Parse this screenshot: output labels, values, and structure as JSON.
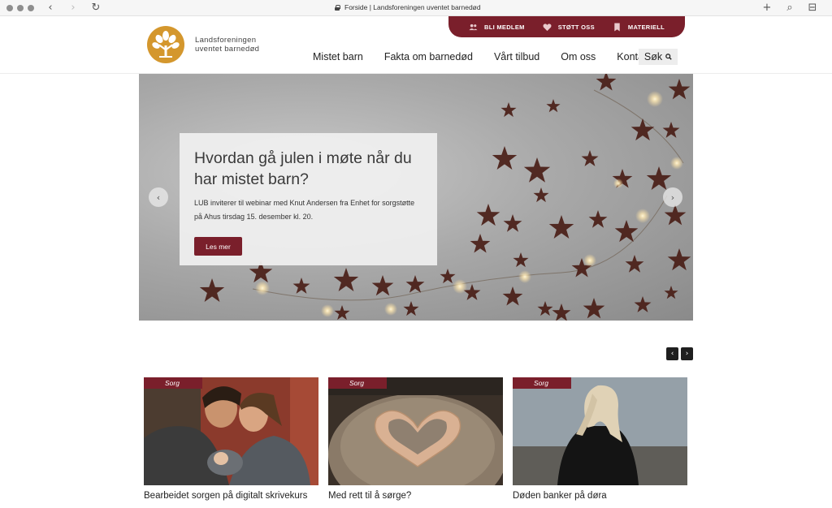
{
  "browser": {
    "url_title": "Forside | Landsforeningen uventet barnedød",
    "back": "‹",
    "forward": "›",
    "reload": "↻",
    "new_tab": "+",
    "search_glyph": "⌕",
    "sidebar_glyph": "⊟"
  },
  "brand": {
    "line1": "Landsforeningen",
    "line2": "uventet barnedød",
    "logo_color": "#d4972d"
  },
  "topbar": {
    "color": "#7a1f2b",
    "items": [
      {
        "label": "BLI MEDLEM",
        "icon": "people-icon"
      },
      {
        "label": "STØTT OSS",
        "icon": "heart-icon"
      },
      {
        "label": "MATERIELL",
        "icon": "bookmark-icon"
      }
    ]
  },
  "nav": {
    "items": [
      "Mistet barn",
      "Fakta om barnedød",
      "Vårt tilbud",
      "Om oss",
      "Kontakt"
    ],
    "search_label": "Søk"
  },
  "hero": {
    "title": "Hvordan gå julen i møte når du har mistet barn?",
    "text": "LUB inviterer til webinar med Knut Andersen fra Enhet for sorgstøtte på Ahus tirsdag 15. desember kl. 20.",
    "button": "Les mer",
    "prev": "‹",
    "next": "›"
  },
  "carousel": {
    "prev": "‹",
    "next": "›"
  },
  "cards": [
    {
      "tag": "Sorg",
      "title": "Bearbeidet sorgen på digitalt skrivekurs"
    },
    {
      "tag": "Sorg",
      "title": "Med rett til å sørge?"
    },
    {
      "tag": "Sorg",
      "title": "Døden banker på døra"
    }
  ]
}
